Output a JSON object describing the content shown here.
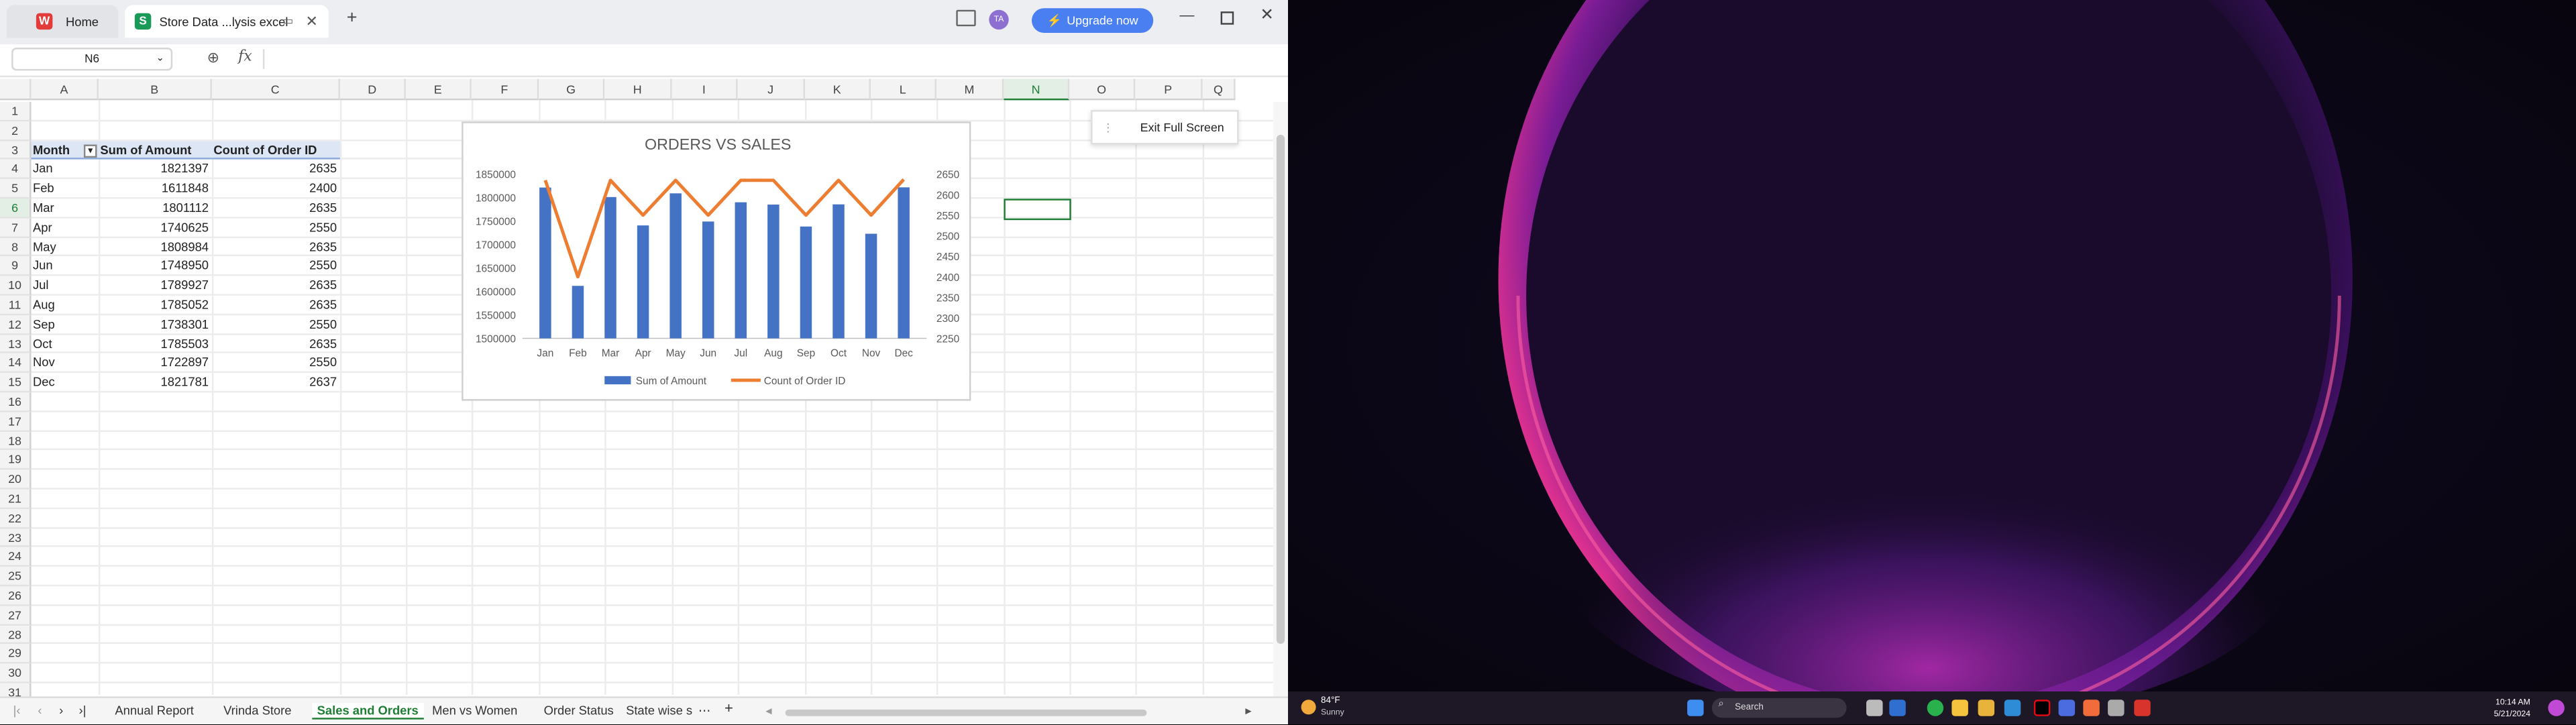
{
  "titlebar": {
    "home_tab": "Home",
    "doc_tab": "Store Data ...lysis excel",
    "upgrade_label": "Upgrade now",
    "avatar_initials": "TA"
  },
  "formula_bar": {
    "name_box": "N6",
    "fx": "fx"
  },
  "columns": [
    "A",
    "B",
    "C",
    "D",
    "E",
    "F",
    "G",
    "H",
    "I",
    "J",
    "K",
    "L",
    "M",
    "N",
    "O",
    "P",
    "Q"
  ],
  "rows": [
    "1",
    "2",
    "3",
    "4",
    "5",
    "6",
    "7",
    "8",
    "9",
    "10",
    "11",
    "12",
    "13",
    "14",
    "15",
    "16",
    "17",
    "18",
    "19",
    "20",
    "21",
    "22",
    "23",
    "24",
    "25",
    "26",
    "27",
    "28",
    "29",
    "30",
    "31"
  ],
  "pivot": {
    "headers": [
      "Month",
      "Sum of Amount",
      "Count of Order ID"
    ],
    "rows": [
      [
        "Jan",
        "1821397",
        "2635"
      ],
      [
        "Feb",
        "1611848",
        "2400"
      ],
      [
        "Mar",
        "1801112",
        "2635"
      ],
      [
        "Apr",
        "1740625",
        "2550"
      ],
      [
        "May",
        "1808984",
        "2635"
      ],
      [
        "Jun",
        "1748950",
        "2550"
      ],
      [
        "Jul",
        "1789927",
        "2635"
      ],
      [
        "Aug",
        "1785052",
        "2635"
      ],
      [
        "Sep",
        "1738301",
        "2550"
      ],
      [
        "Oct",
        "1785503",
        "2635"
      ],
      [
        "Nov",
        "1722897",
        "2550"
      ],
      [
        "Dec",
        "1821781",
        "2637"
      ]
    ]
  },
  "chart_data": {
    "type": "bar",
    "title": "ORDERS VS SALES",
    "categories": [
      "Jan",
      "Feb",
      "Mar",
      "Apr",
      "May",
      "Jun",
      "Jul",
      "Aug",
      "Sep",
      "Oct",
      "Nov",
      "Dec"
    ],
    "series": [
      {
        "name": "Sum of Amount",
        "type": "bar",
        "axis": "left",
        "color": "#4472c4",
        "values": [
          1821397,
          1611848,
          1801112,
          1740625,
          1808984,
          1748950,
          1789927,
          1785052,
          1738301,
          1785503,
          1722897,
          1821781
        ]
      },
      {
        "name": "Count of Order ID",
        "type": "line",
        "axis": "right",
        "color": "#ed7d31",
        "values": [
          2635,
          2400,
          2635,
          2550,
          2635,
          2550,
          2635,
          2635,
          2550,
          2635,
          2550,
          2637
        ]
      }
    ],
    "ylim_left": [
      1500000,
      1850000
    ],
    "yticks_left": [
      "1850000",
      "1800000",
      "1750000",
      "1700000",
      "1650000",
      "1600000",
      "1550000",
      "1500000"
    ],
    "ylim_right": [
      2250,
      2650
    ],
    "yticks_right": [
      "2650",
      "2600",
      "2550",
      "2500",
      "2450",
      "2400",
      "2350",
      "2300",
      "2250"
    ],
    "legend": "bottom"
  },
  "exit_full_screen": "Exit Full Screen",
  "sheet_tabs": [
    "Annual Report",
    "Vrinda Store",
    "Sales and Orders",
    "Men vs Women",
    "Order Status",
    "State wise s"
  ],
  "active_sheet": "Sales and Orders",
  "taskbar": {
    "weather_temp": "84°F",
    "weather_desc": "Sunny",
    "search_placeholder": "Search",
    "time": "10:14 AM",
    "date": "5/21/2024"
  }
}
